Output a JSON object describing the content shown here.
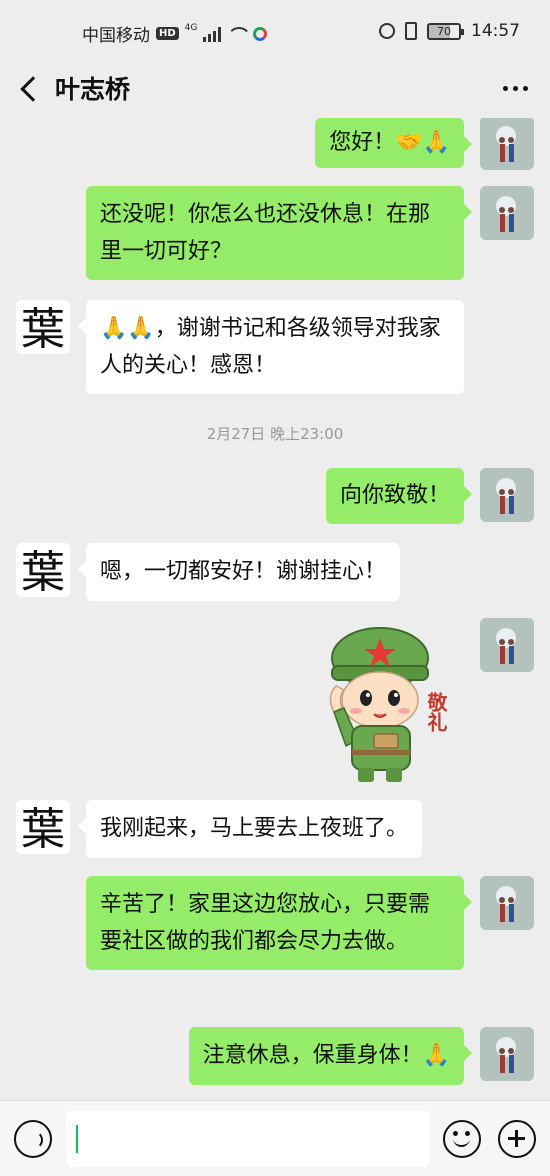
{
  "status_bar": {
    "carrier": "中国移动",
    "hd_badge": "HD",
    "network": "4G",
    "battery": "70",
    "time": "14:57"
  },
  "header": {
    "title": "叶志桥"
  },
  "messages": [
    {
      "side": "me",
      "text": "您好！🤝🙏"
    },
    {
      "side": "me",
      "text": "还没呢！你怎么也还没休息！在那里一切可好？"
    },
    {
      "side": "other",
      "text": "🙏🙏，谢谢书记和各级领导对我家人的关心！感恩！"
    },
    {
      "side": "me",
      "text": "向你致敬！"
    },
    {
      "side": "other",
      "text": "嗯，一切都安好！谢谢挂心！"
    },
    {
      "side": "me",
      "sticker": "salute-soldier",
      "sticker_text": "敬礼"
    },
    {
      "side": "other",
      "text": "我刚起来，马上要去上夜班了。"
    },
    {
      "side": "me",
      "text": "辛苦了！家里这边您放心，只要需要社区做的我们都会尽力去做。"
    },
    {
      "side": "me",
      "text": "注意休息，保重身体！🙏"
    }
  ],
  "timestamp": "2月27日 晚上23:00",
  "avatar_other_char": "葉",
  "colors": {
    "bubble_me": "#95ec69",
    "bubble_other": "#ffffff",
    "background": "#ededed"
  }
}
